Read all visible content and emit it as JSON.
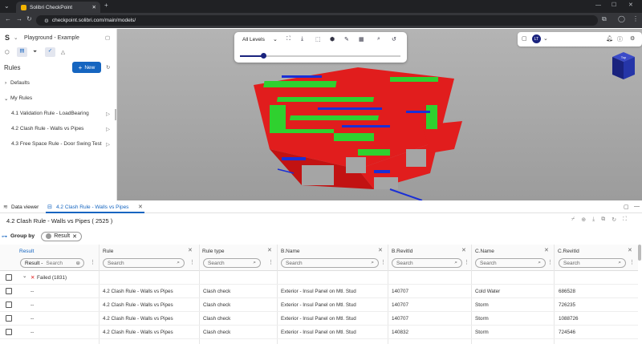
{
  "browser": {
    "tab_title": "Solibri CheckPoint",
    "url": "checkpoint.solibri.com/main/models/"
  },
  "app": {
    "logo": "S",
    "project": "Playground - Example",
    "rules_title": "Rules",
    "new_button": "New",
    "groups": [
      {
        "label": "Defaults"
      },
      {
        "label": "My Rules"
      }
    ],
    "rules": [
      {
        "label": "4.1 Validation Rule - LoadBearing"
      },
      {
        "label": "4.2 Clash Rule - Walls vs Pipes"
      },
      {
        "label": "4.3 Free Space Rule - Door Swing Test"
      }
    ],
    "level_select": "All Levels",
    "avatar": "LT",
    "cube_face": "Top"
  },
  "dataviewer": {
    "tab1": "Data viewer",
    "tab2": "4.2 Clash Rule - Walls vs Pipes",
    "title": "4.2 Clash Rule - Walls vs Pipes ( 2525 )",
    "group_by": "Group by",
    "group_chip": "Result",
    "columns": {
      "result": "Result",
      "rule": "Rule",
      "rule_type": "Rule type",
      "b_name": "B.Name",
      "b_revitid": "B.RevitId",
      "c_name": "C.Name",
      "c_revitid": "C.RevitId"
    },
    "search_placeholder": "Search",
    "result_filter": "Result -",
    "failed_group": "Failed (1831)",
    "rows": [
      {
        "result": "--",
        "rule": "4.2 Clash Rule - Walls vs Pipes",
        "type": "Clash check",
        "bname": "Exterior - Insul Panel on Mtl. Stud",
        "brevit": "140707",
        "cname": "Cold Water",
        "crevit": "686528"
      },
      {
        "result": "--",
        "rule": "4.2 Clash Rule - Walls vs Pipes",
        "type": "Clash check",
        "bname": "Exterior - Insul Panel on Mtl. Stud",
        "brevit": "140707",
        "cname": "Storm",
        "crevit": "726235"
      },
      {
        "result": "--",
        "rule": "4.2 Clash Rule - Walls vs Pipes",
        "type": "Clash check",
        "bname": "Exterior - Insul Panel on Mtl. Stud",
        "brevit": "140707",
        "cname": "Storm",
        "crevit": "1088726"
      },
      {
        "result": "--",
        "rule": "4.2 Clash Rule - Walls vs Pipes",
        "type": "Clash check",
        "bname": "Exterior - Insul Panel on Mtl. Stud",
        "brevit": "140832",
        "cname": "Storm",
        "crevit": "724546"
      }
    ]
  },
  "colors": {
    "accent": "#1565c0",
    "clash_red": "#e11d1d",
    "model_green": "#2fd12f",
    "pipe_blue": "#1a2fd6"
  }
}
